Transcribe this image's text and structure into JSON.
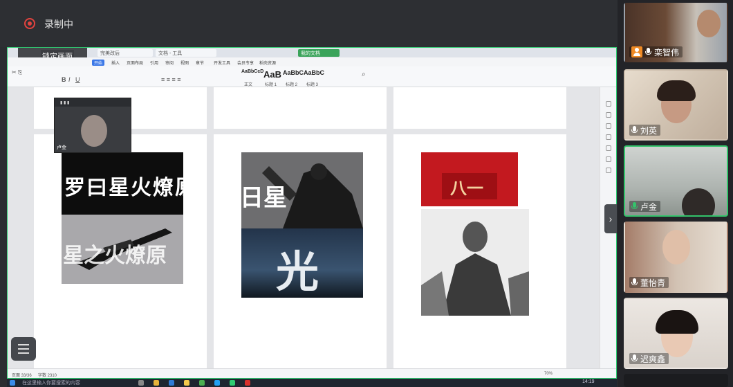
{
  "recording": {
    "label": "录制中",
    "color": "#e2433f"
  },
  "screen_share": {
    "lock_label": "锁定画面",
    "browser_tabs": [
      "完美改后",
      "文档 - 工具",
      "我的文档"
    ],
    "ribbon_menu": [
      "开始",
      "插入",
      "页面布局",
      "引用",
      "审阅",
      "视图",
      "章节",
      "开发工具",
      "会员专享",
      "稻壳资源"
    ],
    "style_gallery": [
      "AaBbCcD",
      "AaB",
      "AaBbC",
      "AaBbC"
    ],
    "style_gallery_names": [
      "正文",
      "标题 1",
      "标题 2",
      "标题 3"
    ],
    "artworks": {
      "page1_top_text": "罗曰星火燎原",
      "page1_bottom_text": "星之火燎原",
      "page2_top_text": "日星",
      "page2_bottom_text": "光",
      "page3_banner_text": "八一"
    },
    "pip_participant": "卢金",
    "status_left": "页面 33/36",
    "status_words": "字数 2310",
    "status_zoom": "70%"
  },
  "taskbar": {
    "search_placeholder": "在这里输入你要搜索的内容",
    "time": "14:19"
  },
  "participants": [
    {
      "name": "栾智伟",
      "role": "host",
      "mic": "white",
      "active": false
    },
    {
      "name": "刘英",
      "role": "member",
      "mic": "white",
      "active": false
    },
    {
      "name": "卢金",
      "role": "member",
      "mic": "green",
      "active": true
    },
    {
      "name": "董怡青",
      "role": "member",
      "mic": "white",
      "active": false
    },
    {
      "name": "迟爽鑫",
      "role": "member",
      "mic": "white",
      "active": false
    }
  ],
  "colors": {
    "active_border": "#33c46b",
    "host_badge": "#f08a24",
    "banner_red": "#c3191f"
  }
}
